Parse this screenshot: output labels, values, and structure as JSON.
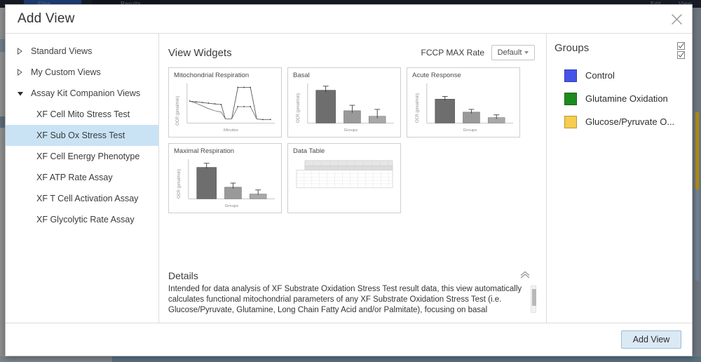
{
  "backdrop": {
    "tab_labels": [
      "Files",
      "Results"
    ],
    "right_labels": [
      "Edit",
      "View"
    ]
  },
  "dialog": {
    "title": "Add View",
    "close_icon": "close-icon"
  },
  "nav": {
    "items": [
      {
        "label": "Standard Views",
        "type": "group",
        "expanded": false,
        "selected": false
      },
      {
        "label": "My Custom Views",
        "type": "group",
        "expanded": false,
        "selected": false
      },
      {
        "label": "Assay Kit Companion Views",
        "type": "group",
        "expanded": true,
        "selected": false
      },
      {
        "label": "XF Cell Mito Stress Test",
        "type": "child",
        "selected": false
      },
      {
        "label": "XF Sub Ox Stress Test",
        "type": "child",
        "selected": true
      },
      {
        "label": "XF Cell Energy Phenotype",
        "type": "child",
        "selected": false
      },
      {
        "label": "XF ATP Rate Assay",
        "type": "child",
        "selected": false
      },
      {
        "label": "XF T Cell Activation Assay",
        "type": "child",
        "selected": false
      },
      {
        "label": "XF Glycolytic Rate Assay",
        "type": "child",
        "selected": false
      }
    ]
  },
  "widgets_panel": {
    "title": "View Widgets",
    "fccp_label": "FCCP MAX Rate",
    "fccp_value": "Default",
    "widgets": [
      {
        "title": "Mitochondrial Respiration",
        "kind": "line",
        "ylabel": "OCR (pmol/min)",
        "xlabel": "Minutes"
      },
      {
        "title": "Basal",
        "kind": "bar",
        "ylabel": "OCR (pmol/min)",
        "xlabel": "Groups"
      },
      {
        "title": "Acute Response",
        "kind": "bar",
        "ylabel": "OCR (pmol/min)",
        "xlabel": "Groups"
      },
      {
        "title": "Maximal Respiration",
        "kind": "bar",
        "ylabel": "OCR (pmol/min)",
        "xlabel": "Groups"
      },
      {
        "title": "Data Table",
        "kind": "table",
        "ylabel": "",
        "xlabel": ""
      }
    ]
  },
  "details": {
    "title": "Details",
    "text": "Intended for data analysis of XF Substrate Oxidation Stress Test result data, this view automatically calculates functional mitochondrial parameters of any XF Substrate Oxidation Stress Test (i.e. Glucose/Pyruvate, Glutamine, Long Chain Fatty Acid and/or Palmitate), focusing on basal respiration, acute response to",
    "collapse_icon": "chevron-up-icon"
  },
  "groups": {
    "title": "Groups",
    "select_all_icon": "checkbox-checked-icon",
    "items": [
      {
        "label": "Control",
        "color": "#4553e8"
      },
      {
        "label": "Glutamine Oxidation",
        "color": "#1d8a20"
      },
      {
        "label": "Glucose/Pyruvate O...",
        "color": "#f5cc4d"
      }
    ]
  },
  "footer": {
    "add_view_label": "Add View"
  },
  "chart_data": [
    {
      "type": "line",
      "title": "Mitochondrial Respiration",
      "xlabel": "Minutes",
      "ylabel": "OCR (pmol/min)",
      "x": [
        1,
        2,
        3,
        4,
        5,
        6,
        7,
        8,
        9,
        10,
        11,
        12
      ],
      "series": [
        {
          "name": "upper",
          "values": [
            60,
            59,
            58,
            57,
            56,
            55,
            22,
            22,
            96,
            96,
            96,
            18
          ]
        },
        {
          "name": "lower",
          "values": [
            60,
            57,
            52,
            47,
            43,
            40,
            22,
            22,
            48,
            48,
            48,
            18
          ]
        }
      ],
      "grid": false,
      "legend": "none"
    },
    {
      "type": "bar",
      "title": "Basal",
      "xlabel": "Groups",
      "ylabel": "OCR (pmol/min)",
      "categories": [
        "Control",
        "Glutamine Oxidation",
        "Glucose/Pyruvate O..."
      ],
      "values": [
        88,
        33,
        17
      ],
      "errors": [
        6,
        10,
        12
      ],
      "grid": false
    },
    {
      "type": "bar",
      "title": "Acute Response",
      "xlabel": "Groups",
      "ylabel": "OCR (pmol/min)",
      "categories": [
        "Control",
        "Glutamine Oxidation",
        "Glucose/Pyruvate O..."
      ],
      "values": [
        62,
        28,
        13
      ],
      "errors": [
        4,
        4,
        3
      ],
      "grid": false
    },
    {
      "type": "bar",
      "title": "Maximal Respiration",
      "xlabel": "Groups",
      "ylabel": "OCR (pmol/min)",
      "categories": [
        "Control",
        "Glutamine Oxidation",
        "Glucose/Pyruvate O..."
      ],
      "values": [
        86,
        30,
        12
      ],
      "errors": [
        6,
        6,
        5
      ],
      "grid": false
    },
    {
      "type": "table",
      "title": "Data Table",
      "columns": 11,
      "rows": 5
    }
  ]
}
